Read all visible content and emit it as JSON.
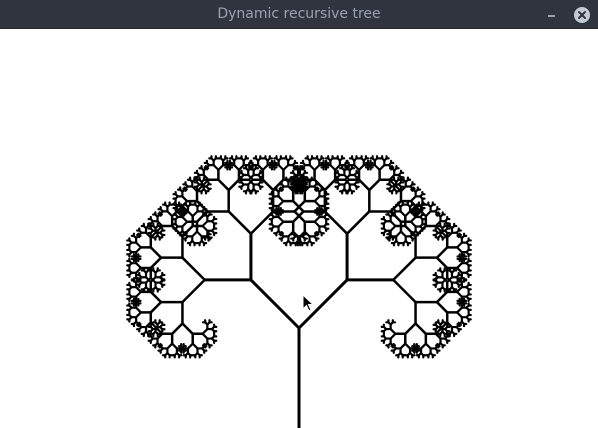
{
  "window": {
    "title": "Dynamic recursive tree"
  },
  "titlebar": {
    "minimize_icon": "minimize-icon",
    "close_icon": "close-icon"
  },
  "tree": {
    "color": "#000000",
    "background": "#ffffff",
    "branch_angle_deg": 45,
    "length_ratio": 0.68,
    "depth": 10
  },
  "cursor": {
    "icon": "arrow-cursor-icon"
  }
}
